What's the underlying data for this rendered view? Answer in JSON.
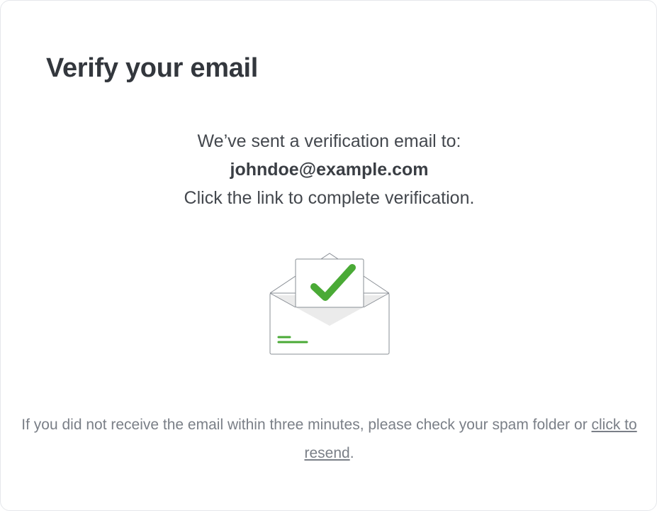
{
  "page": {
    "title": "Verify your email"
  },
  "message": {
    "line1": "We’ve sent a verification email to:",
    "email": "johndoe@example.com",
    "line2": "Click the link to complete verification."
  },
  "illustration": {
    "icon": "envelope-check-icon",
    "accent_color": "#4aaa36"
  },
  "footer": {
    "text_before": "If you did not receive the email within three minutes, please check your spam folder or ",
    "resend_link": "click to resend",
    "text_after": "."
  }
}
